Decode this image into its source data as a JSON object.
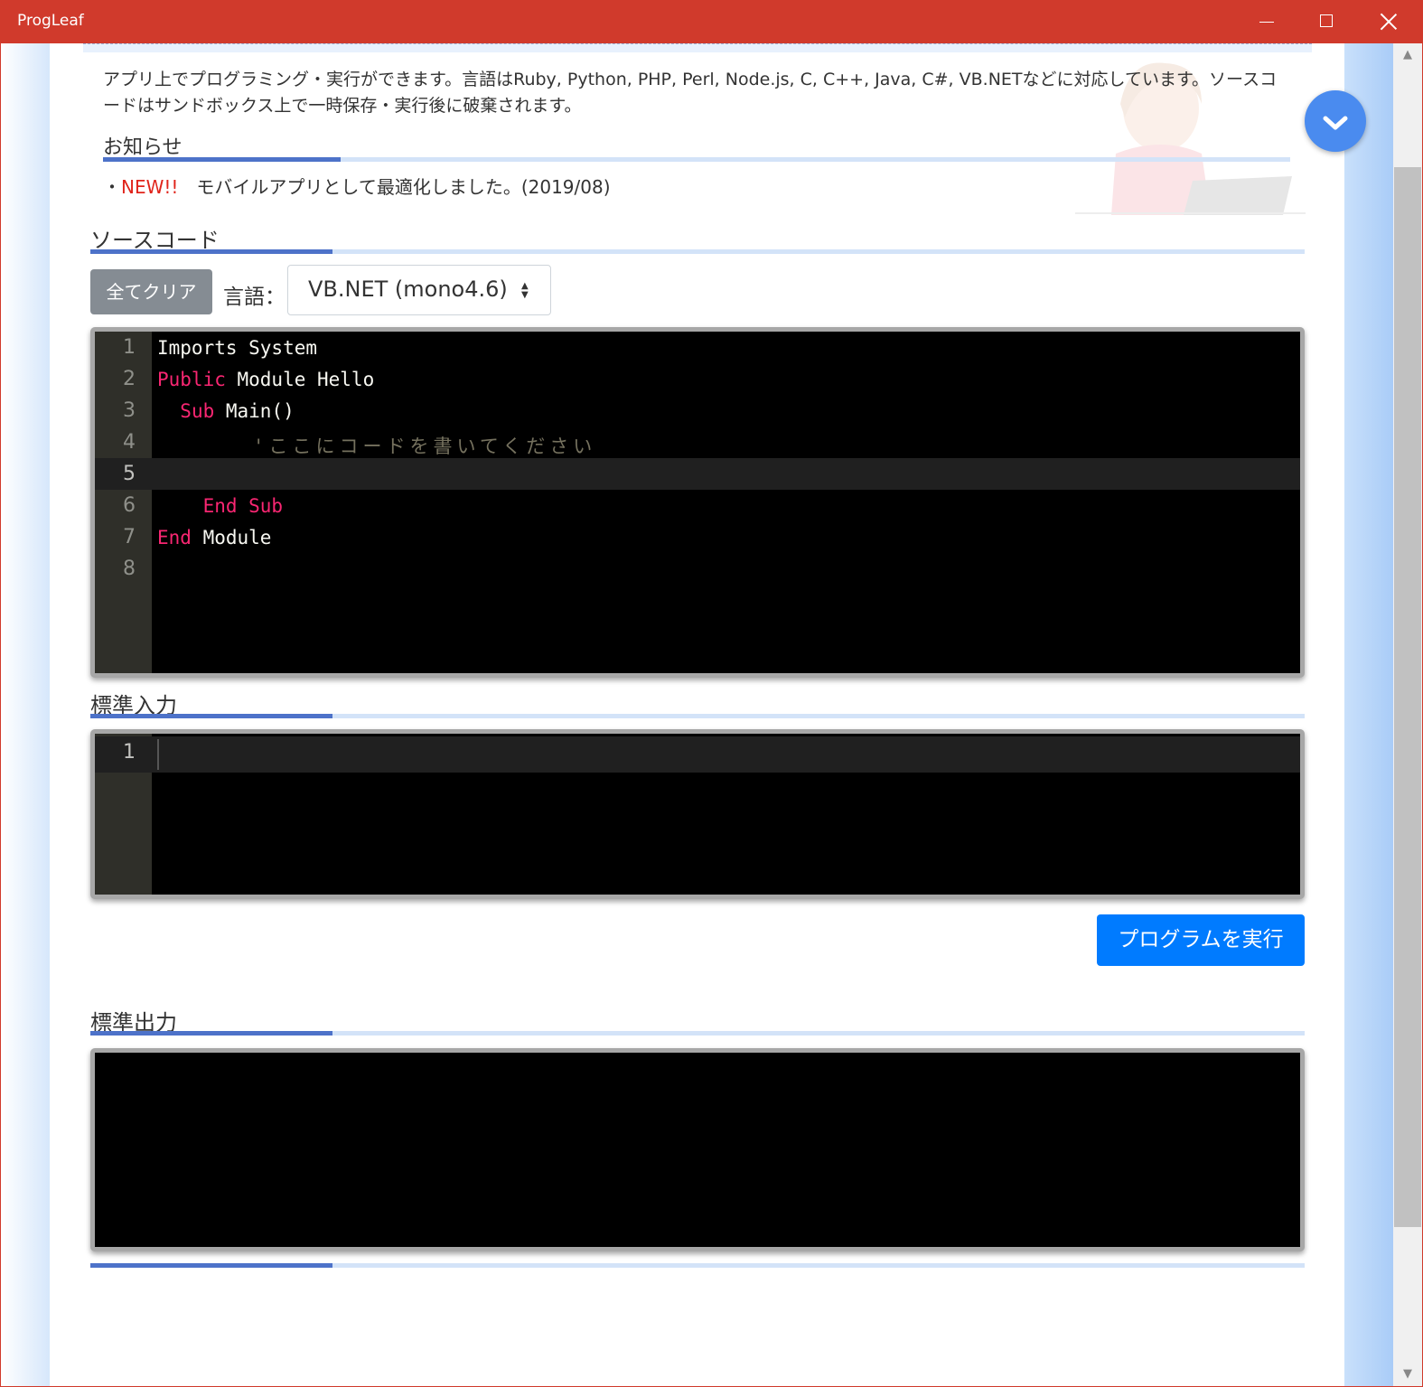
{
  "window": {
    "title": "ProgLeaf",
    "controls": [
      "minimize-icon",
      "maximize-icon",
      "close-icon"
    ]
  },
  "intro": {
    "text": "アプリ上でプログラミング・実行ができます。言語はRuby, Python, PHP, Perl, Node.js, C, C++, Java, C#, VB.NETなどに対応しています。ソースコードはサンドボックス上で一時保存・実行後に破棄されます。"
  },
  "news": {
    "heading": "お知らせ",
    "bullet": "・",
    "badge": "NEW!!",
    "text": "　モバイルアプリとして最適化しました。(2019/08)"
  },
  "source": {
    "heading": "ソースコード",
    "clear_label": "全てクリア",
    "lang_label": "言語：",
    "lang_value": "VB.NET (mono4.6)",
    "active_line": 5,
    "lines": [
      {
        "num": "1",
        "tokens": [
          {
            "t": "Imports System",
            "c": "plain"
          }
        ]
      },
      {
        "num": "2",
        "tokens": [
          {
            "t": "Public",
            "c": "kw"
          },
          {
            "t": " Module Hello",
            "c": "plain"
          }
        ]
      },
      {
        "num": "3",
        "tokens": [
          {
            "t": "  ",
            "c": "plain"
          },
          {
            "t": "Sub",
            "c": "kw"
          },
          {
            "t": " Main()",
            "c": "plain"
          }
        ]
      },
      {
        "num": "4",
        "tokens": [
          {
            "t": "      'ここにコードを書いてください",
            "c": "cmt"
          }
        ]
      },
      {
        "num": "5",
        "tokens": []
      },
      {
        "num": "6",
        "tokens": [
          {
            "t": "    ",
            "c": "plain"
          },
          {
            "t": "End Sub",
            "c": "kw"
          }
        ]
      },
      {
        "num": "7",
        "tokens": [
          {
            "t": "End",
            "c": "kw"
          },
          {
            "t": " Module",
            "c": "plain"
          }
        ]
      },
      {
        "num": "8",
        "tokens": []
      }
    ]
  },
  "stdin": {
    "heading": "標準入力",
    "lines": [
      {
        "num": "1"
      }
    ]
  },
  "run_label": "プログラムを実行",
  "stdout": {
    "heading": "標準出力"
  },
  "colors": {
    "titlebar": "#d03a2c",
    "accent_rule": "#4d72c9",
    "run_button": "#007bff",
    "keyword": "#f92672",
    "new_badge": "#e0241b"
  }
}
